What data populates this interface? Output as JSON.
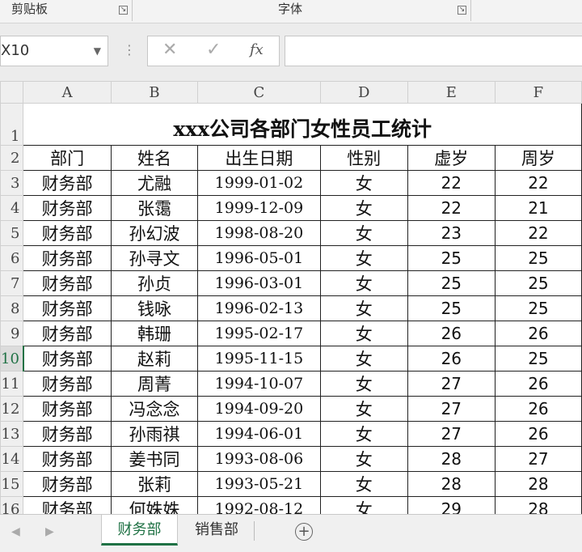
{
  "ribbon": {
    "clipboard_label": "剪贴板",
    "font_label": "字体",
    "launcher_glyph": "↘"
  },
  "formula_bar": {
    "name_box": "X10",
    "dropdown_glyph": "▼",
    "dots": "⋮",
    "cancel_glyph": "✕",
    "enter_glyph": "✓",
    "fx_label": "fx",
    "formula_value": ""
  },
  "columns": [
    "A",
    "B",
    "C",
    "D",
    "E",
    "F"
  ],
  "row_numbers": [
    "1",
    "2",
    "3",
    "4",
    "5",
    "6",
    "7",
    "8",
    "9",
    "10",
    "11",
    "12",
    "13",
    "14",
    "15",
    "16"
  ],
  "sheet": {
    "title": "xxx公司各部门女性员工统计",
    "headers": [
      "部门",
      "姓名",
      "出生日期",
      "性别",
      "虚岁",
      "周岁"
    ],
    "rows": [
      [
        "财务部",
        "尤融",
        "1999-01-02",
        "女",
        "22",
        "22"
      ],
      [
        "财务部",
        "张霭",
        "1999-12-09",
        "女",
        "22",
        "21"
      ],
      [
        "财务部",
        "孙幻波",
        "1998-08-20",
        "女",
        "23",
        "22"
      ],
      [
        "财务部",
        "孙寻文",
        "1996-05-01",
        "女",
        "25",
        "25"
      ],
      [
        "财务部",
        "孙贞",
        "1996-03-01",
        "女",
        "25",
        "25"
      ],
      [
        "财务部",
        "钱咏",
        "1996-02-13",
        "女",
        "25",
        "25"
      ],
      [
        "财务部",
        "韩珊",
        "1995-02-17",
        "女",
        "26",
        "26"
      ],
      [
        "财务部",
        "赵莉",
        "1995-11-15",
        "女",
        "26",
        "25"
      ],
      [
        "财务部",
        "周菁",
        "1994-10-07",
        "女",
        "27",
        "26"
      ],
      [
        "财务部",
        "冯念念",
        "1994-09-20",
        "女",
        "27",
        "26"
      ],
      [
        "财务部",
        "孙雨祺",
        "1994-06-01",
        "女",
        "27",
        "26"
      ],
      [
        "财务部",
        "姜书同",
        "1993-08-06",
        "女",
        "28",
        "27"
      ],
      [
        "财务部",
        "张莉",
        "1993-05-21",
        "女",
        "28",
        "28"
      ],
      [
        "财务部",
        "何姝姝",
        "1992-08-12",
        "女",
        "29",
        "28"
      ]
    ]
  },
  "tabs": {
    "prev_glyph": "◀",
    "next_glyph": "▶",
    "active": "财务部",
    "other": "销售部",
    "add_glyph": "+"
  },
  "colors": {
    "accent": "#207245"
  }
}
